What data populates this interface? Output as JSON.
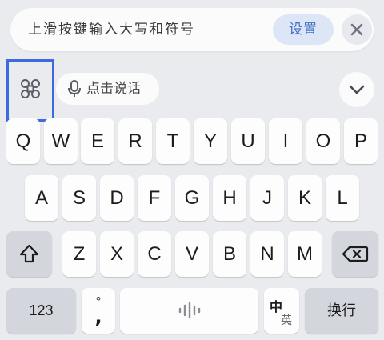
{
  "suggestion_bar": {
    "hint": "上滑按键输入大写和符号",
    "settings_label": "设置",
    "close_icon": "close-icon"
  },
  "toolbar": {
    "menu_icon": "command-grid-icon",
    "voice_label": "点击说话",
    "voice_icon": "microphone-icon",
    "collapse_icon": "chevron-down-icon"
  },
  "keyboard": {
    "row1": [
      "Q",
      "W",
      "E",
      "R",
      "T",
      "Y",
      "U",
      "I",
      "O",
      "P"
    ],
    "row2": [
      "A",
      "S",
      "D",
      "F",
      "G",
      "H",
      "J",
      "K",
      "L"
    ],
    "row3": [
      "Z",
      "X",
      "C",
      "V",
      "B",
      "N",
      "M"
    ],
    "shift_icon": "shift-arrow-icon",
    "delete_icon": "backspace-icon",
    "number_label": "123",
    "punct_top": "°",
    "punct_main": ",",
    "space_icon": "voice-wave-icon",
    "lang_primary": "中",
    "lang_secondary": "英",
    "enter_label": "换行"
  },
  "colors": {
    "accent": "#3f6fc6",
    "highlight_border": "#3d6ae0",
    "background": "#e9ebef",
    "key": "#fdfdfd",
    "func_key": "#d3d6dc"
  }
}
